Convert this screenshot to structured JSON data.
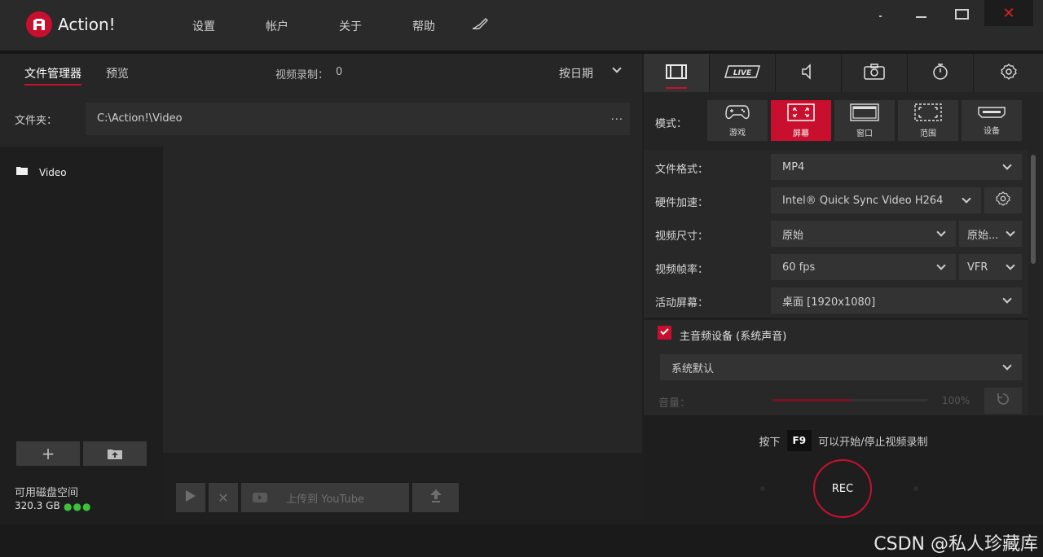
{
  "app": {
    "name": "Action!"
  },
  "menu": [
    "设置",
    "帐户",
    "关于",
    "帮助"
  ],
  "left": {
    "tabs": [
      {
        "label": "文件管理器"
      },
      {
        "label": "预览"
      }
    ],
    "recording_label": "视频录制：",
    "recording_count": "0",
    "sort_label": "按日期",
    "folder_label": "文件夹：",
    "folder_path": "C:\\Action!\\Video",
    "folder_more": "...",
    "tree": [
      {
        "label": "Video"
      }
    ],
    "disk_label": "可用磁盘空间",
    "disk_value": "320.3 GB",
    "upload_label": "上传到 YouTube"
  },
  "right": {
    "mode_label": "模式：",
    "modes": [
      {
        "label": "游戏"
      },
      {
        "label": "屏幕"
      },
      {
        "label": "窗口"
      },
      {
        "label": "范围"
      },
      {
        "label": "设备"
      }
    ],
    "fields": {
      "format_label": "文件格式：",
      "format_value": "MP4",
      "hw_label": "硬件加速：",
      "hw_value": "Intel® Quick Sync Video H264",
      "size_label": "视频尺寸：",
      "size_value": "原始",
      "size_value2": "原始...",
      "fps_label": "视频帧率：",
      "fps_value": "60 fps",
      "fps_mode": "VFR",
      "screen_label": "活动屏幕：",
      "screen_value": "桌面 [1920x1080]",
      "audio_label": "主音频设备 (系统声音)",
      "audio_value": "系统默认",
      "volume_label": "音量：",
      "volume_value": "100%"
    },
    "hint_prefix": "按下",
    "hint_key": "F9",
    "hint_suffix": "可以开始/停止视频录制",
    "rec_label": "REC"
  },
  "watermark": "CSDN @私人珍藏库",
  "colors": {
    "accent": "#c8102e",
    "disk_dots": "#3cc13c"
  }
}
